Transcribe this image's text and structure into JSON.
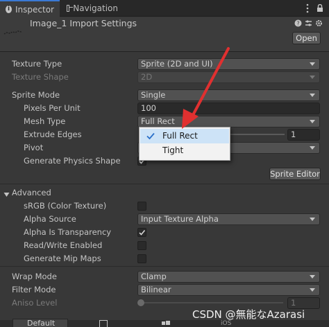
{
  "tabs": {
    "inspector": "Inspector",
    "navigation": "Navigation"
  },
  "header": {
    "title": "Image_1 Import Settings",
    "open_button": "Open"
  },
  "texture_type": {
    "label": "Texture Type",
    "value": "Sprite (2D and UI)"
  },
  "texture_shape": {
    "label": "Texture Shape",
    "value": "2D"
  },
  "sprite_mode": {
    "label": "Sprite Mode",
    "value": "Single"
  },
  "pixels_per_unit": {
    "label": "Pixels Per Unit",
    "value": "100"
  },
  "mesh_type": {
    "label": "Mesh Type",
    "value": "Full Rect"
  },
  "extrude_edges": {
    "label": "Extrude Edges",
    "value": "1",
    "level": 1.0
  },
  "pivot": {
    "label": "Pivot"
  },
  "generate_physics_shape": {
    "label": "Generate Physics Shape",
    "checked": true
  },
  "sprite_editor_button": "Sprite Editor",
  "advanced": {
    "label": "Advanced"
  },
  "srgb": {
    "label": "sRGB (Color Texture)",
    "checked": false
  },
  "alpha_source": {
    "label": "Alpha Source",
    "value": "Input Texture Alpha"
  },
  "alpha_is_transparency": {
    "label": "Alpha Is Transparency",
    "checked": true
  },
  "read_write": {
    "label": "Read/Write Enabled",
    "checked": false
  },
  "mipmaps": {
    "label": "Generate Mip Maps",
    "checked": false
  },
  "wrap_mode": {
    "label": "Wrap Mode",
    "value": "Clamp"
  },
  "filter_mode": {
    "label": "Filter Mode",
    "value": "Bilinear"
  },
  "aniso_level": {
    "label": "Aniso Level",
    "value": "1",
    "level": 0.0
  },
  "popup": {
    "items": [
      {
        "label": "Full Rect",
        "selected": true
      },
      {
        "label": "Tight",
        "selected": false
      }
    ]
  },
  "platform_tabs": {
    "default": "Default",
    "ios": "iOS"
  },
  "watermark": "CSDN @無能なAzarasi",
  "colors": {
    "accent": "#3a79d4",
    "arrow": "#e03030",
    "background": "#383838"
  }
}
